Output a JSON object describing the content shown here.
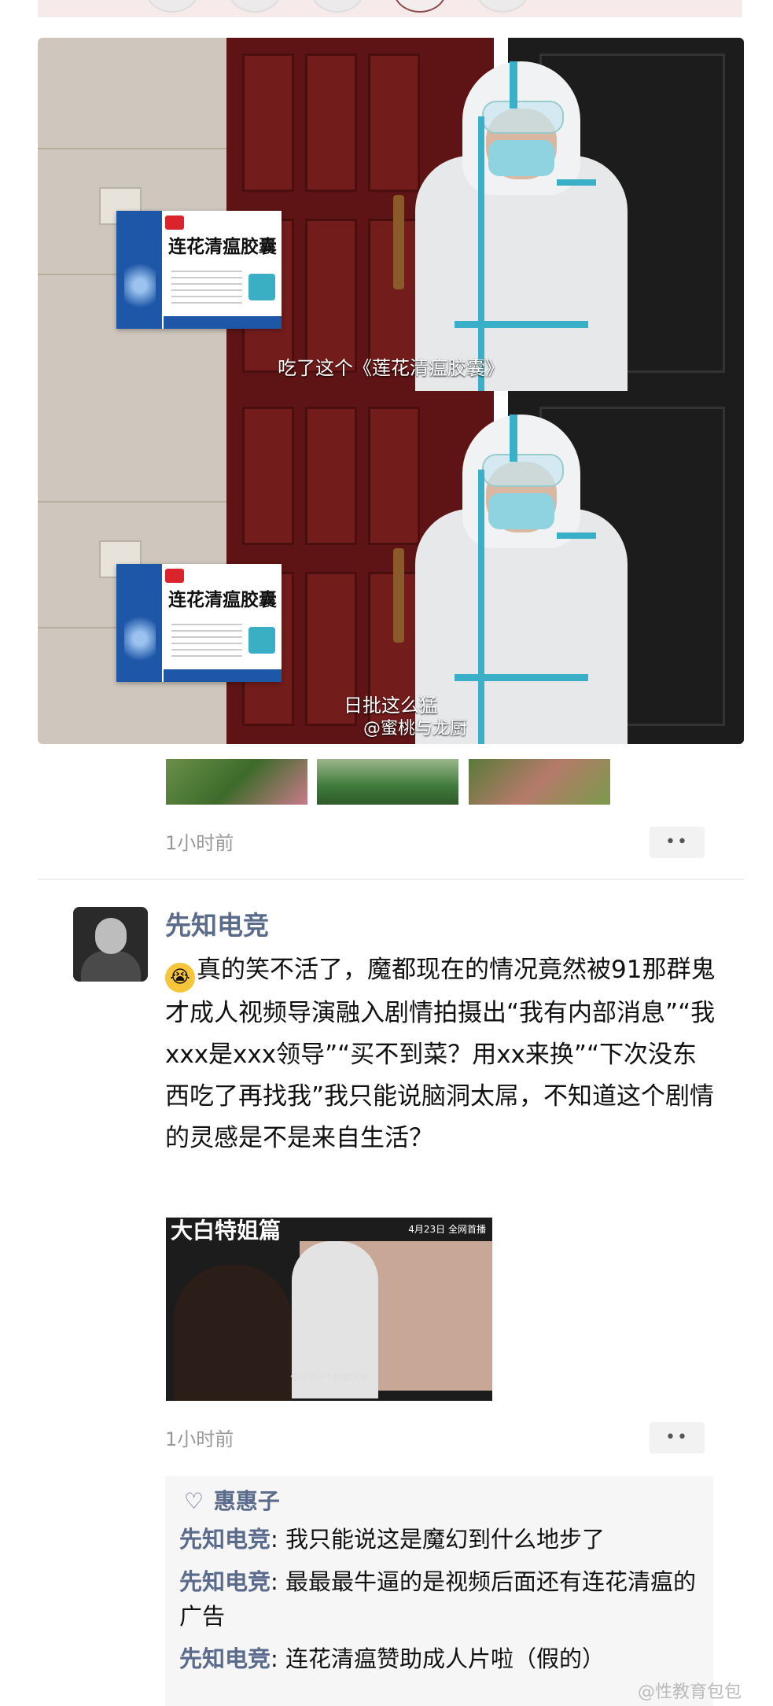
{
  "post1": {
    "images": {
      "box_title": "连花清瘟胶囊",
      "caption_top": "吃了这个《莲花清瘟胶囊》",
      "caption_bottom": "日批这么猛",
      "watermark": "@蜜桃与龙厨"
    },
    "time": "1小时前",
    "more": "••"
  },
  "post2": {
    "author": "先知电竞",
    "emoji": "😭",
    "text": "真的笑不活了，魔都现在的情况竟然被91那群鬼才成人视频导演融入剧情拍摄出“我有内部消息”“我xxx是xxx领导”“买不到菜？用xx来换”“下次没东西吃了再找我”我只能说脑洞太屌，不知道这个剧情的灵感是不是来自生活？",
    "video": {
      "title": "大白特姐篇",
      "date": "4月23日  全网首播",
      "subtitle": "告诉你一个内部消息"
    },
    "time": "1小时前",
    "more": "••"
  },
  "comments": {
    "liked_by": "惠惠子",
    "items": [
      {
        "name": "先知电竞",
        "text": "我只能说这是魔幻到什么地步了"
      },
      {
        "name": "先知电竞",
        "text": "最最最牛逼的是视频后面还有连花清瘟的广告"
      },
      {
        "name": "先知电竞",
        "text": "连花清瘟赞助成人片啦（假的）"
      }
    ]
  },
  "footer_watermark": "@性教育包包"
}
